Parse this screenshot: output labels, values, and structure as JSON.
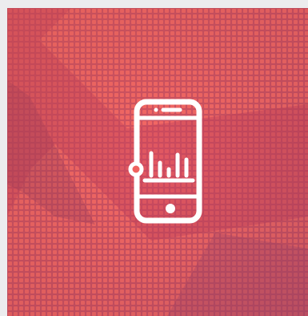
{
  "card": {
    "icon": "mobile-analytics-icon",
    "background_motif": "pixelated-arrow-cursor",
    "colors": {
      "tile_base": "#f0625f",
      "pixel_light": "#ff6f66",
      "pixel_dark": "#c94862",
      "arrow_shadow": "#d2485a",
      "icon_stroke": "#ffffff",
      "page_background": "#ececee"
    }
  }
}
